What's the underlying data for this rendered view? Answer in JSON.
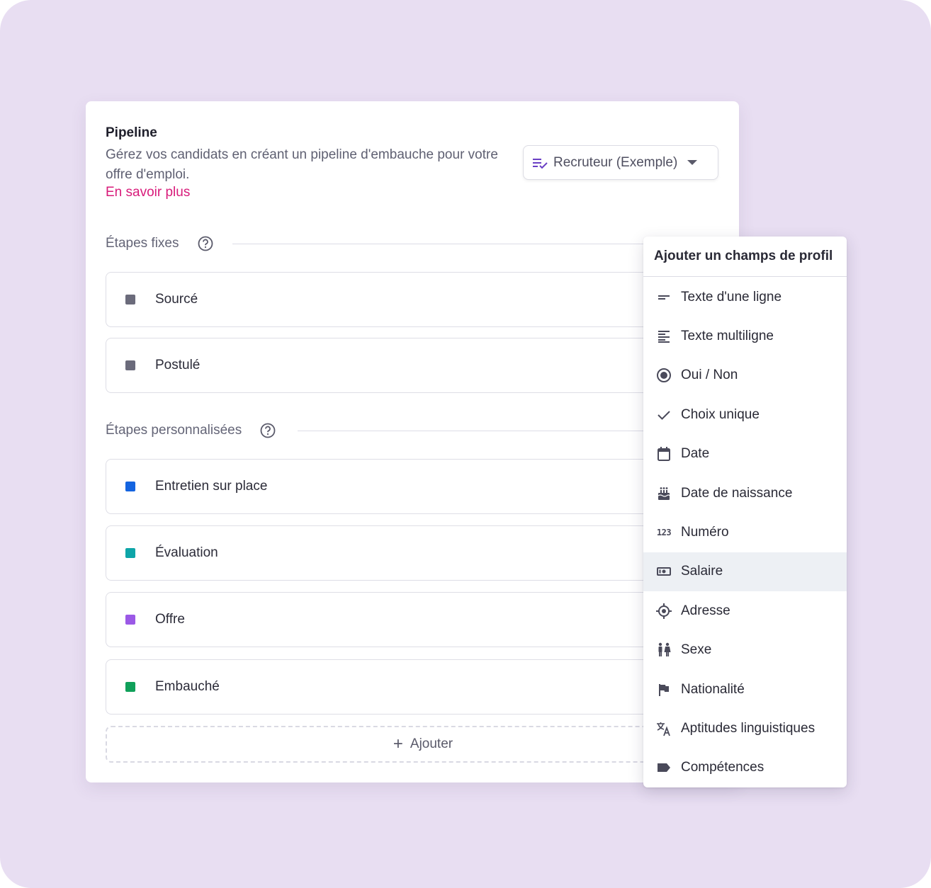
{
  "pipeline": {
    "title": "Pipeline",
    "description": "Gérez vos candidats en créant un pipeline d'embauche pour votre offre d'emploi.",
    "learn_more": "En savoir plus",
    "template_select": "Recruteur (Exemple)"
  },
  "fixed_section": {
    "label": "Étapes fixes",
    "stages": [
      {
        "label": "Sourcé",
        "color": "#6b6b7b"
      },
      {
        "label": "Postulé",
        "color": "#6b6b7b"
      }
    ]
  },
  "custom_section": {
    "label": "Étapes personnalisées",
    "stages": [
      {
        "label": "Entretien sur place",
        "color": "#1464e0"
      },
      {
        "label": "Évaluation",
        "color": "#0ea5a8"
      },
      {
        "label": "Offre",
        "color": "#9b59e6"
      },
      {
        "label": "Embauché",
        "color": "#10a05a"
      }
    ]
  },
  "add_button": "Ajouter",
  "menu": {
    "header": "Ajouter un champs de profil",
    "items": [
      {
        "label": "Texte d'une ligne",
        "icon": "short-text-icon"
      },
      {
        "label": "Texte multiligne",
        "icon": "multiline-text-icon"
      },
      {
        "label": "Oui / Non",
        "icon": "radio-icon"
      },
      {
        "label": "Choix unique",
        "icon": "check-icon"
      },
      {
        "label": "Date",
        "icon": "calendar-icon"
      },
      {
        "label": "Date de naissance",
        "icon": "cake-icon"
      },
      {
        "label": "Numéro",
        "icon": "number-icon"
      },
      {
        "label": "Salaire",
        "icon": "money-icon"
      },
      {
        "label": "Adresse",
        "icon": "location-icon"
      },
      {
        "label": "Sexe",
        "icon": "gender-icon"
      },
      {
        "label": "Nationalité",
        "icon": "flag-icon"
      },
      {
        "label": "Aptitudes linguistiques",
        "icon": "translate-icon"
      },
      {
        "label": "Compétences",
        "icon": "label-icon"
      }
    ],
    "active_item": "Salaire"
  }
}
